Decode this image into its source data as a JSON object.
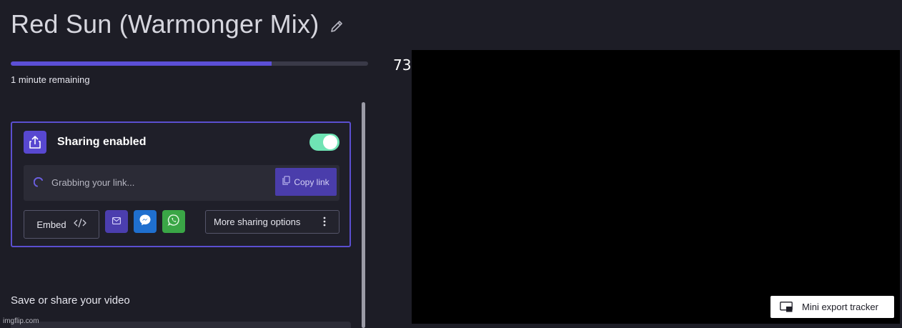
{
  "header": {
    "title": "Red Sun (Warmonger Mix)",
    "edit_icon": "pencil-icon"
  },
  "export": {
    "progress_fraction": 0.73,
    "percent_label": "73",
    "remaining_text": "1 minute remaining"
  },
  "sharing": {
    "title": "Sharing enabled",
    "toggle_on": true,
    "link_placeholder": "Grabbing your link...",
    "copy_label": "Copy link",
    "embed_label": "Embed",
    "more_label": "More sharing options",
    "icons": [
      "share-icon",
      "spinner-icon",
      "copy-icon",
      "code-icon",
      "email-icon",
      "messenger-icon",
      "whatsapp-icon",
      "kebab-icon"
    ]
  },
  "save_section": {
    "heading": "Save or share your video"
  },
  "tracker": {
    "label": "Mini export tracker",
    "icon": "picture-in-picture-icon"
  },
  "watermark": "imgflip.com",
  "colors": {
    "background": "#1d1d26",
    "accent": "#5848d0",
    "toggle_on": "#6fe3b4",
    "email_button": "#4b3eae",
    "messenger_button": "#1f6fcf",
    "whatsapp_button": "#3aa646",
    "video_bg": "#000000"
  }
}
